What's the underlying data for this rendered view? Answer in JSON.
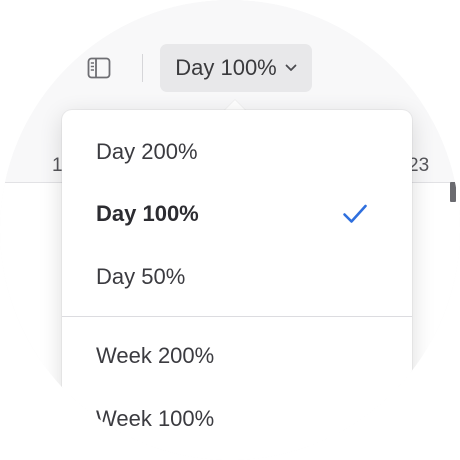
{
  "toolbar": {
    "sidebar_icon": "sidebar-icon",
    "zoom_label": "Day 100%",
    "zoom_chevron_icon": "chevron-down-icon"
  },
  "timeline": {
    "tick_left": "1",
    "tick_right": "23"
  },
  "menu": {
    "items": [
      {
        "label": "Day 200%",
        "selected": false
      },
      {
        "label": "Day 100%",
        "selected": true
      },
      {
        "label": "Day 50%",
        "selected": false
      },
      {
        "label": "Week 200%",
        "selected": false
      },
      {
        "label": "Week 100%",
        "selected": false
      }
    ],
    "check_icon": "checkmark-icon",
    "check_color": "#2f6fde"
  },
  "colors": {
    "accent": "#2f6fde",
    "toolbar_bg": "#f8f8f9",
    "button_bg": "#e8e8ea"
  }
}
